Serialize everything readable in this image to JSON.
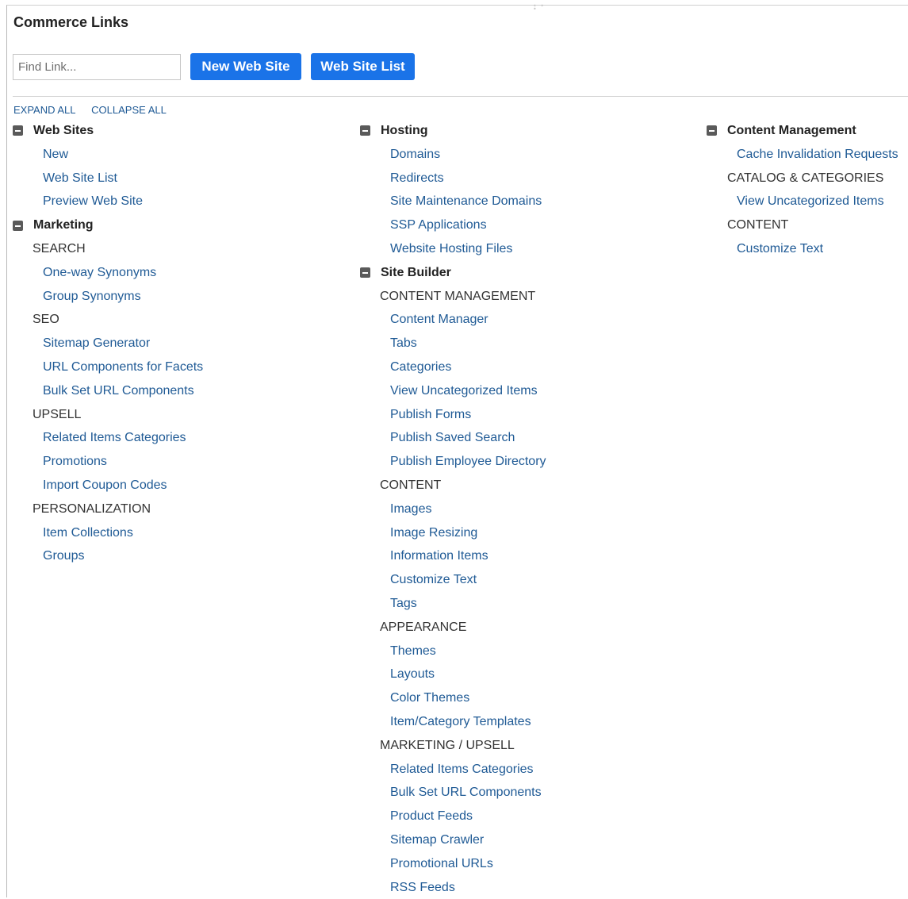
{
  "page": {
    "title": "Commerce Links",
    "find_placeholder": "Find Link...",
    "buttons": {
      "new_web_site": "New Web Site",
      "web_site_list": "Web Site List"
    },
    "expand_all": "EXPAND ALL",
    "collapse_all": "COLLAPSE ALL"
  },
  "colors": {
    "accent": "#1a73e8",
    "link": "#1f5a95",
    "heading": "#222222"
  },
  "columns": [
    {
      "sections": [
        {
          "title": "Web Sites",
          "groups": [
            {
              "heading": "",
              "links": [
                "New",
                "Web Site List",
                "Preview Web Site"
              ]
            }
          ]
        },
        {
          "title": "Marketing",
          "groups": [
            {
              "heading": "SEARCH",
              "links": [
                "One-way Synonyms",
                "Group Synonyms"
              ]
            },
            {
              "heading": "SEO",
              "links": [
                "Sitemap Generator",
                "URL Components for Facets",
                "Bulk Set URL Components"
              ]
            },
            {
              "heading": "UPSELL",
              "links": [
                "Related Items Categories",
                "Promotions",
                "Import Coupon Codes"
              ]
            },
            {
              "heading": "PERSONALIZATION",
              "links": [
                "Item Collections",
                "Groups"
              ]
            }
          ]
        }
      ]
    },
    {
      "sections": [
        {
          "title": "Hosting",
          "groups": [
            {
              "heading": "",
              "links": [
                "Domains",
                "Redirects",
                "Site Maintenance Domains",
                "SSP Applications",
                "Website Hosting Files"
              ]
            }
          ]
        },
        {
          "title": "Site Builder",
          "groups": [
            {
              "heading": "CONTENT MANAGEMENT",
              "links": [
                "Content Manager",
                "Tabs",
                "Categories",
                "View Uncategorized Items",
                "Publish Forms",
                "Publish Saved Search",
                "Publish Employee Directory"
              ]
            },
            {
              "heading": "CONTENT",
              "links": [
                "Images",
                "Image Resizing",
                "Information Items",
                "Customize Text",
                "Tags"
              ]
            },
            {
              "heading": "APPEARANCE",
              "links": [
                "Themes",
                "Layouts",
                "Color Themes",
                "Item/Category Templates"
              ]
            },
            {
              "heading": "MARKETING / UPSELL",
              "links": [
                "Related Items Categories",
                "Bulk Set URL Components",
                "Product Feeds",
                "Sitemap Crawler",
                "Promotional URLs",
                "RSS Feeds"
              ]
            }
          ]
        }
      ]
    },
    {
      "sections": [
        {
          "title": "Content Management",
          "groups": [
            {
              "heading": "",
              "links": [
                "Cache Invalidation Requests"
              ]
            },
            {
              "heading": "CATALOG & CATEGORIES",
              "links": [
                "View Uncategorized Items"
              ]
            },
            {
              "heading": "CONTENT",
              "links": [
                "Customize Text"
              ]
            }
          ]
        }
      ]
    }
  ]
}
